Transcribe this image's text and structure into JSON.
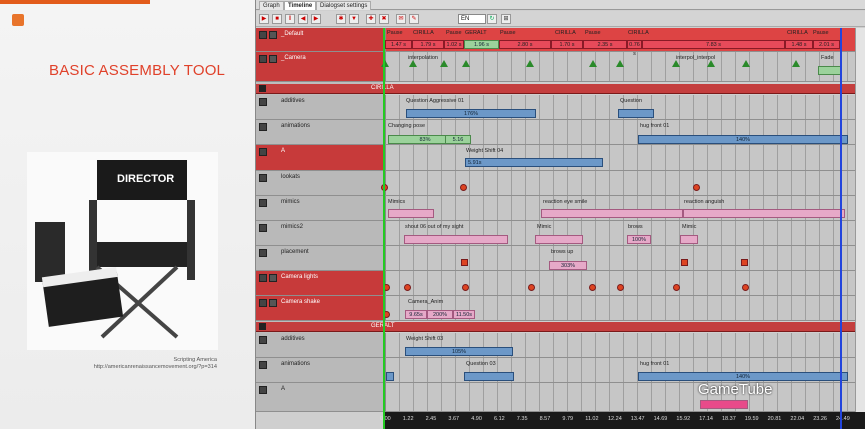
{
  "slide": {
    "title": "BASIC ASSEMBLY TOOL",
    "caption1": "Scripting America",
    "caption2": "http://americanrenaissancemovement.org/?p=314",
    "chair_label": "DIRECTOR"
  },
  "tabs": [
    "Graph",
    "Timeline",
    "Dialogset settings"
  ],
  "toolbar": {
    "language": "EN"
  },
  "tracks": {
    "default": "_Default",
    "camera": "_Camera",
    "cirilla": "CIRILLA",
    "geralt": "GERALT",
    "additives": "additives",
    "animations": "animations",
    "a": "A",
    "lookats": "lookats",
    "mimics": "mimics",
    "mimics2": "mimics2",
    "placement": "placement",
    "camera_lights": "Camera lights",
    "camera_shake": "Camera shake"
  },
  "clips": {
    "pause": "Pause",
    "cirilla": "CIRILLA",
    "geralt": "GERALT",
    "d1": "1.47 s",
    "d2": "1.79 s",
    "d3": "1.02 s",
    "d4": "1.96 s",
    "d5": "2.80 s",
    "d6": "1.70 s",
    "d7": "2.35 s",
    "d8": "0.76 s",
    "d9": "7.83 s",
    "d10": "1.48 s",
    "d11": "2.01 s",
    "interpolation": "interpolation",
    "interpol": "interpol_interpol",
    "fade": "Fade",
    "q_aggr": "Question Aggressive 01",
    "q": "Question",
    "pct176": "176%",
    "changing_pose": "Changing pose",
    "hug_front": "hug front 01",
    "pct83": "83%",
    "s516": "5.16",
    "pct140": "140%",
    "weight_shift04": "Weight Shift 04",
    "s591": "5.91s",
    "mimics": "Mimics",
    "reaction_eye": "reaction eye smile",
    "reaction_ang": "reaction anguish",
    "shout": "shout 06 out of my sight",
    "mimic": "Mimic",
    "brows": "brows",
    "pct100": "100%",
    "brows_up": "brows up",
    "pct303": "303%",
    "cam_anim": "Camera_Anim",
    "s965": "9.65s",
    "pct200": "200%",
    "s1150": "11.50s",
    "weight_shift03": "Weight Shift 03",
    "pct105": "105%",
    "question03": "Question 03"
  },
  "ruler": [
    "0.00",
    "1.22",
    "2.45",
    "3.67",
    "4.90",
    "6.12",
    "7.35",
    "8.57",
    "9.79",
    "11.02",
    "12.24",
    "13.47",
    "14.69",
    "15.92",
    "17.14",
    "18.37",
    "19.59",
    "20.81",
    "22.04",
    "23.26",
    "24.49"
  ],
  "watermark": "GameTube"
}
